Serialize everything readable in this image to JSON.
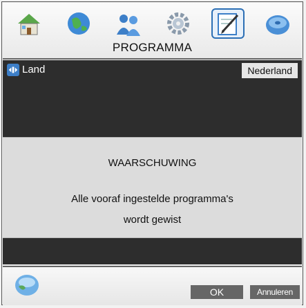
{
  "menu": {
    "title": "PROGRAMMA",
    "icons": [
      "home-icon",
      "globe-icon",
      "people-icon",
      "gear-icon",
      "edit-icon",
      "disc-icon"
    ],
    "active_icon": "edit-icon"
  },
  "settings": {
    "land_label": "Land",
    "land_value": "Nederland"
  },
  "dialog": {
    "title": "WAARSCHUWING",
    "message_line1": "Alle vooraf ingestelde programma's",
    "message_line2": "wordt gewist"
  },
  "buttons": {
    "ok_label": "OK",
    "cancel_label": "Annuleren"
  },
  "colors": {
    "panel_bg": "#2d2d2d",
    "dialog_bg": "#dcdcdc",
    "button_bg": "#666666",
    "accent": "#2c6fb5"
  }
}
